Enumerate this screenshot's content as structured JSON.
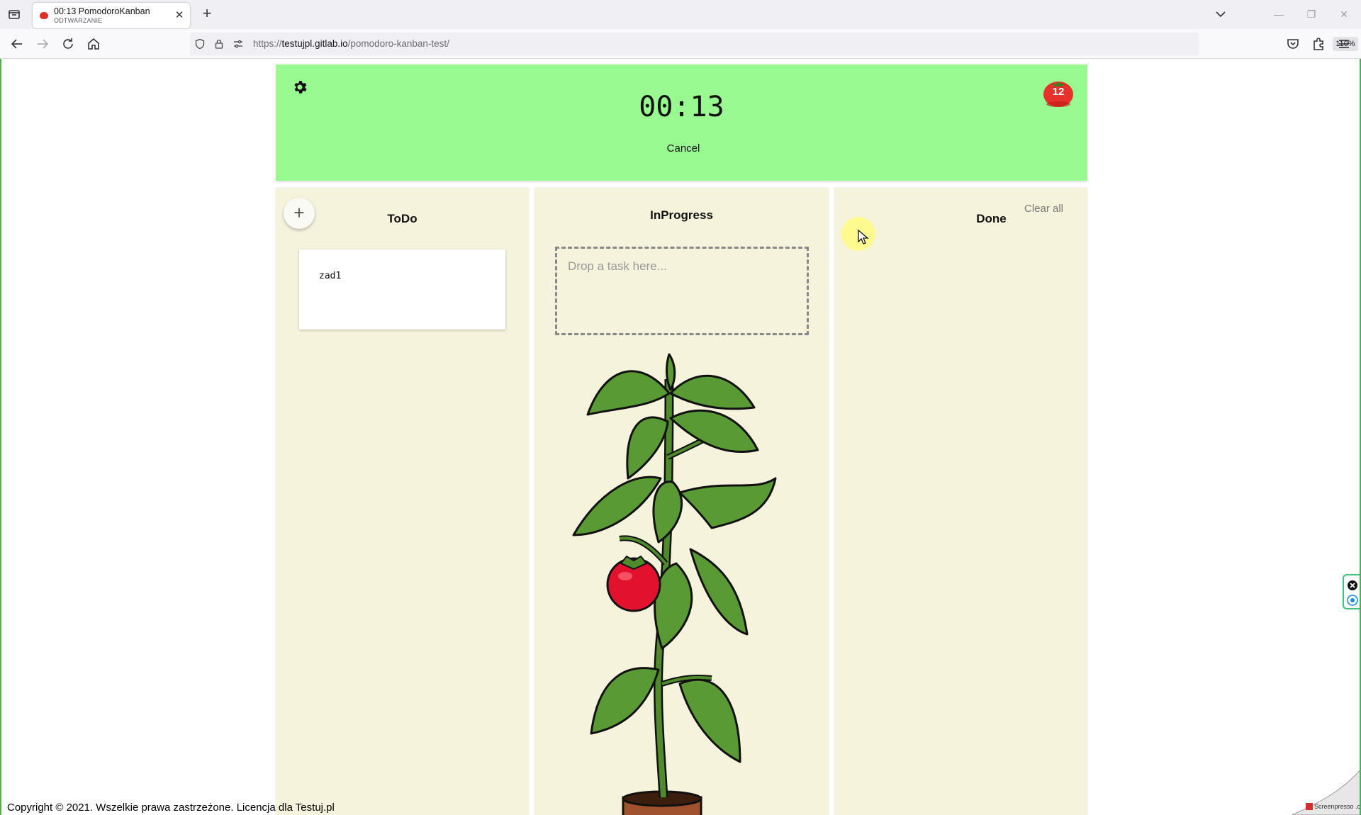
{
  "browser": {
    "tab": {
      "title": "00:13 PomodoroKanban",
      "subtitle": "ODTWARZANIE",
      "favicon": "tomato-icon"
    },
    "url_prefix": "https://",
    "url_host": "testujpl.gitlab.io",
    "url_path": "/pomodoro-kanban-test/",
    "zoom": "110%"
  },
  "timer": {
    "value": "00:13",
    "cancel_label": "Cancel",
    "pomodoro_count": "12",
    "background": "#99fa92"
  },
  "columns": {
    "todo": {
      "title": "ToDo",
      "add_label": "+",
      "tasks": [
        "zad1"
      ]
    },
    "in_progress": {
      "title": "InProgress",
      "drop_placeholder": "Drop a task here..."
    },
    "done": {
      "title": "Done",
      "clear_label": "Clear all"
    },
    "background": "#f5f3dc"
  },
  "footer": {
    "copyright": "Copyright © 2021. Wszelkie prawa zastrzeżone. Licencja dla Testuj.pl"
  },
  "watermark": "Screenpresso .com"
}
